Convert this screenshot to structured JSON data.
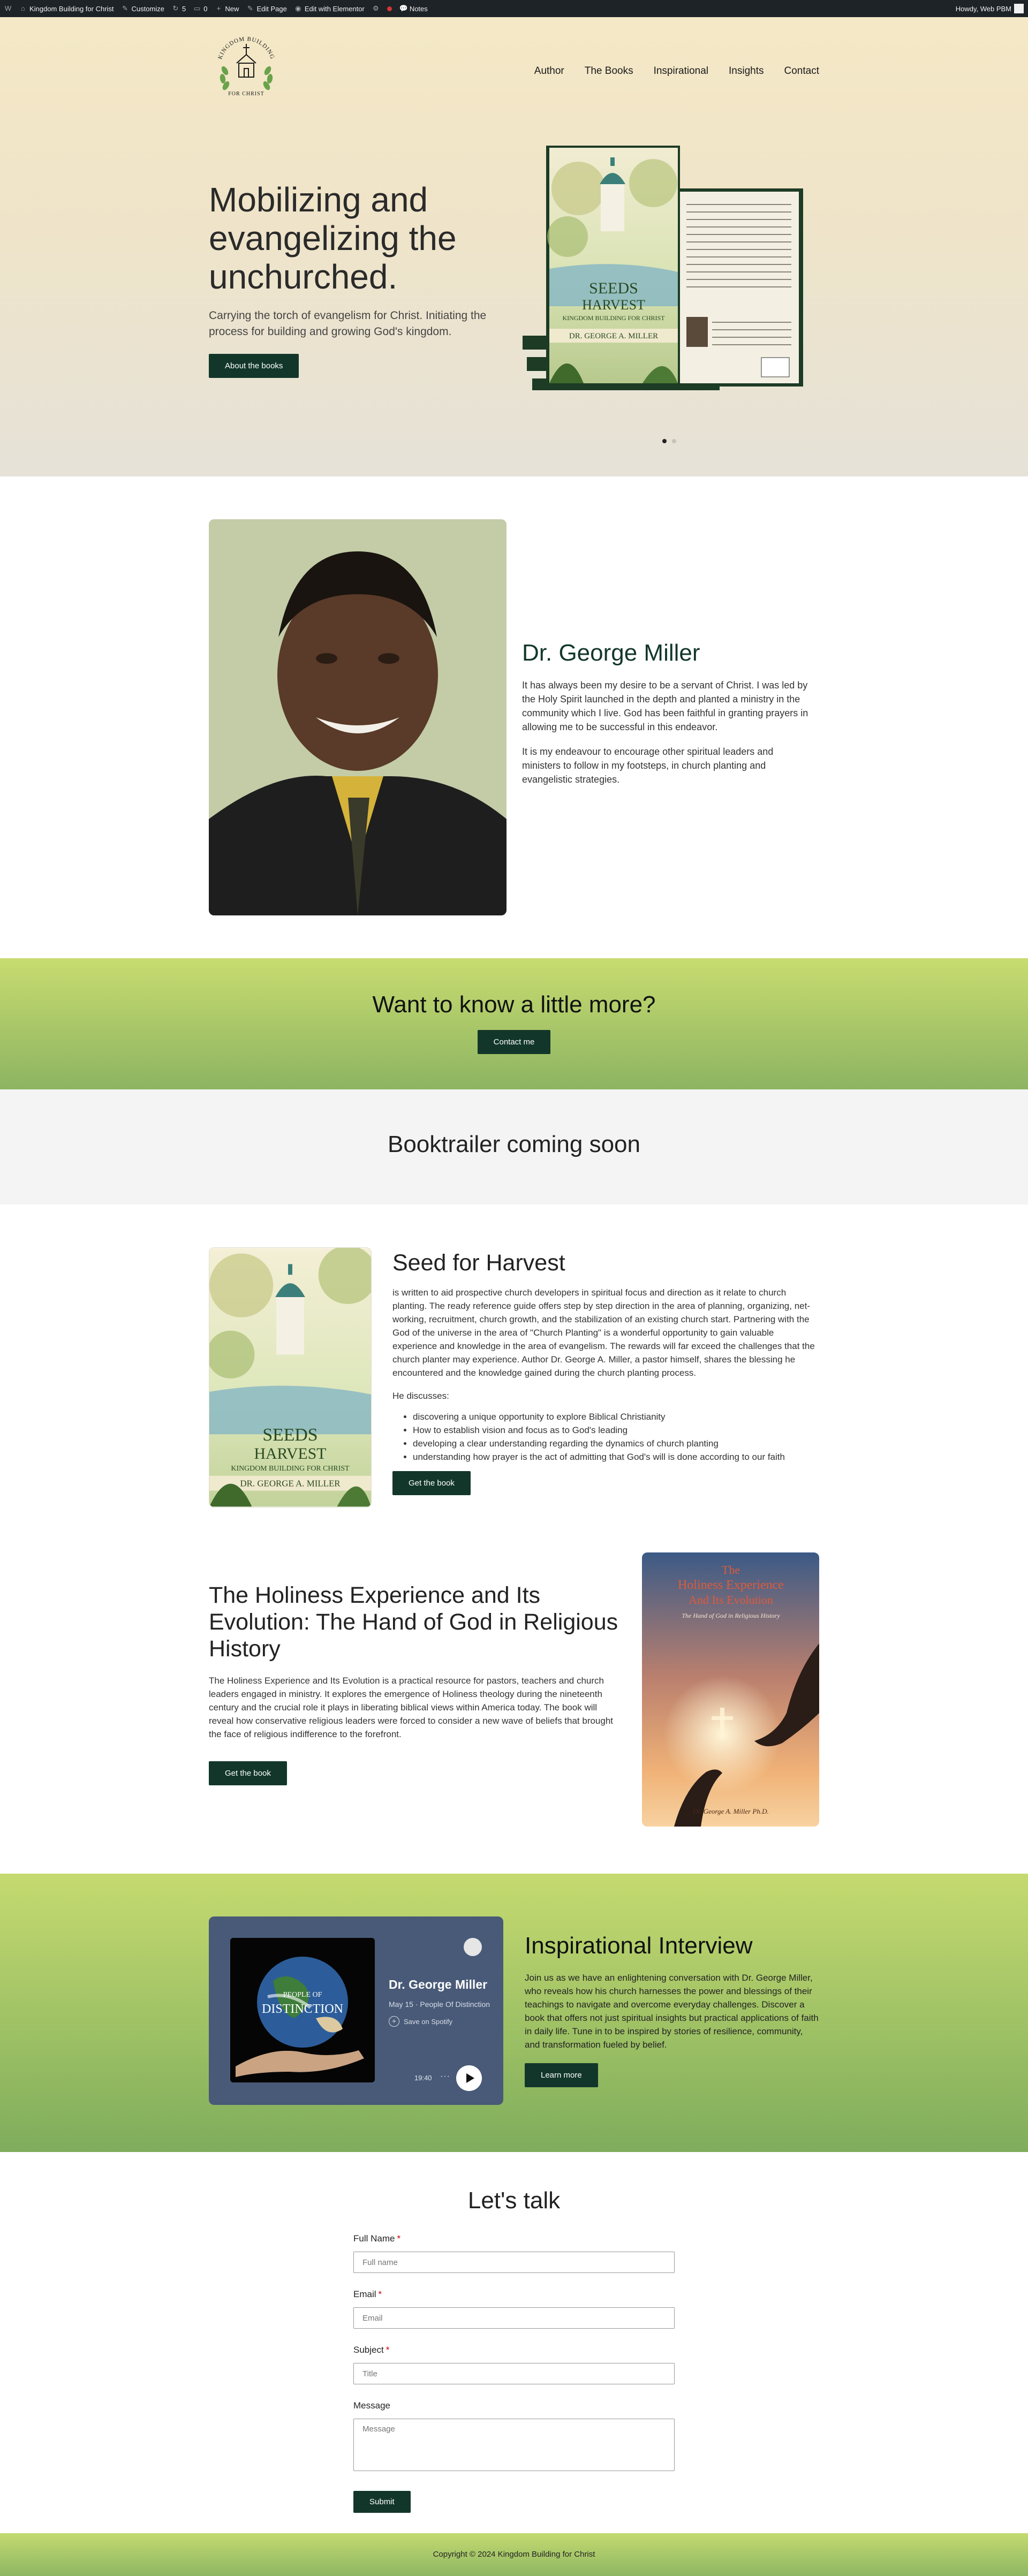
{
  "adminbar": {
    "site_name": "Kingdom Building for Christ",
    "customize": "Customize",
    "revisions_count": "5",
    "comments_count": "0",
    "new_label": "New",
    "edit_page": "Edit Page",
    "edit_elementor": "Edit with Elementor",
    "notes": "Notes",
    "howdy": "Howdy, Web PBM"
  },
  "header": {
    "logo_text_top": "KINGDOM BUILDING",
    "logo_text_bottom": "FOR CHRIST",
    "nav": [
      "Author",
      "The Books",
      "Inspirational",
      "Insights",
      "Contact"
    ]
  },
  "hero": {
    "title": "Mobilizing and evangelizing the unchurched.",
    "subtitle": "Carrying the torch of evangelism for Christ. Initiating the process for building and growing God's kingdom.",
    "button": "About the books",
    "book_title_1": "SEEDS",
    "book_title_2": "HARVEST",
    "book_subtitle": "KINGDOM BUILDING FOR CHRIST",
    "book_author": "DR. GEORGE A. MILLER",
    "slides": 2,
    "active_slide": 1
  },
  "about": {
    "name": "Dr. George Miller",
    "p1": "It has always been my desire to be a servant of Christ. I was led by the Holy Spirit launched in the depth and planted a ministry in the community which I live. God has been faithful in granting prayers in allowing me to be successful in this endeavor.",
    "p2": "It is my endeavour to encourage other spiritual leaders and ministers to follow in my footsteps, in church planting and evangelistic strategies."
  },
  "cta": {
    "title": "Want to know a little more?",
    "button": "Contact me"
  },
  "trailer": {
    "title": "Booktrailer coming soon"
  },
  "book1": {
    "title": "Seed for Harvest",
    "description": "is written to aid prospective church developers in spiritual focus and direction as it relate to church planting. The ready reference guide offers step by step direction in the area of planning, organizing, net-working, recruitment, church growth, and the stabilization of an existing church start. Partnering with the God of the universe in the area of \"Church Planting\" is a wonderful opportunity to gain valuable experience and knowledge in the area of evangelism. The rewards will far exceed the challenges that the church planter may experience. Author Dr. George A. Miller, a pastor himself, shares the blessing he encountered and the knowledge gained during the church planting process.",
    "discusses": "He discusses:",
    "items": [
      "discovering a unique opportunity to explore Biblical Christianity",
      "How to establish vision and focus as to God's leading",
      "developing a clear understanding regarding the dynamics of church planting",
      "understanding how prayer is the act of admitting that God's will is done according to our faith"
    ],
    "button": "Get the book",
    "cover_title_1": "SEEDS",
    "cover_title_2": "HARVEST",
    "cover_subtitle": "KINGDOM BUILDING FOR CHRIST",
    "cover_author": "DR. GEORGE A. MILLER"
  },
  "book2": {
    "title": "The Holiness Experience and Its Evolution: The Hand of God in Religious History",
    "description": "The Holiness Experience and Its Evolution is a practical resource for pastors, teachers and church leaders engaged in ministry. It explores the emergence of Holiness theology during the nineteenth century and the crucial role it plays in liberating biblical views within America today. The book will reveal how conservative religious leaders were forced to consider a new wave of beliefs that brought the face of religious indifference to the forefront.",
    "button": "Get the book",
    "cover_title_1": "The",
    "cover_title_2": "Holiness Experience",
    "cover_title_3": "And Its Evolution",
    "cover_subtitle": "The Hand of God in Religious History",
    "cover_author": "Dr. George A. Miller Ph.D."
  },
  "interview": {
    "spotify_title": "Dr. George Miller",
    "spotify_meta": "May 15 · People Of Distinction",
    "spotify_save": "Save on Spotify",
    "spotify_time": "19:40",
    "art_text_1": "PEOPLE OF",
    "art_text_2": "DISTINCTION",
    "title": "Inspirational Interview",
    "description": "Join us as we have an enlightening conversation with Dr. George Miller, who reveals how his church harnesses the power and blessings of their teachings to navigate and overcome everyday challenges. Discover a book that offers not just spiritual insights but practical applications of faith in daily life. Tune in to be inspired by stories of resilience, community, and transformation fueled by belief.",
    "button": "Learn more"
  },
  "contact": {
    "title": "Let's talk",
    "fullname_label": "Full Name",
    "fullname_placeholder": "Full name",
    "email_label": "Email",
    "email_placeholder": "Email",
    "subject_label": "Subject",
    "subject_placeholder": "Title",
    "message_label": "Message",
    "message_placeholder": "Message",
    "required_mark": "*",
    "submit": "Submit"
  },
  "footer": {
    "copyright": "Copyright © 2024 Kingdom Building for Christ"
  },
  "colors": {
    "accent": "#12372a",
    "green_light": "#c8dc70",
    "green_dark": "#8db462",
    "hero_bg": "#f4e8c6"
  }
}
